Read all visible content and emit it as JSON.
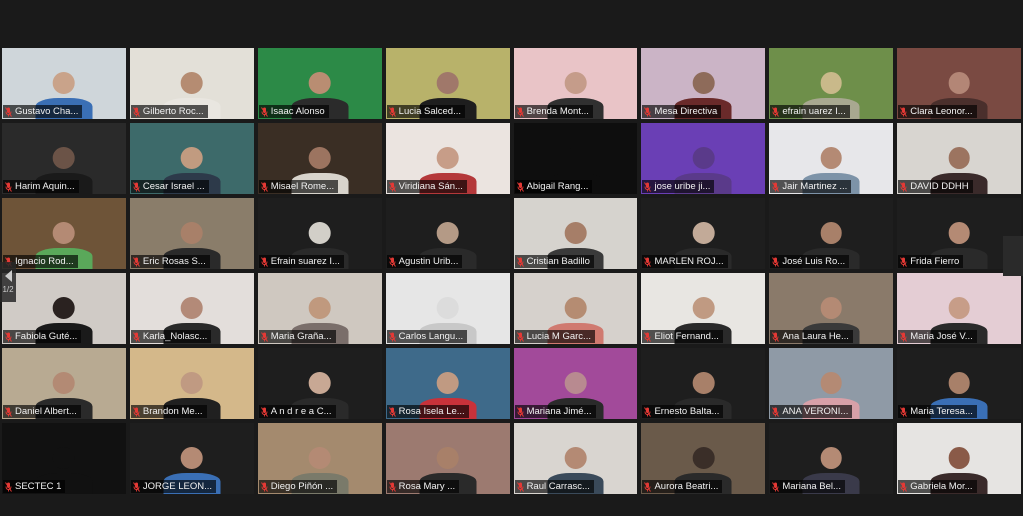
{
  "meeting": {
    "page_indicator": "1/2"
  },
  "colors": {
    "label_bg": "#000000a6",
    "muted_mic": "#e53935",
    "background": "#1a1a1a"
  },
  "participants": [
    {
      "name": "Gustavo Cha...",
      "bg": "#cfd6da",
      "skin": "#c9a38a",
      "shirt": "#3a6fb5",
      "muted": true
    },
    {
      "name": "Gilberto Roc...",
      "bg": "#e3e0d8",
      "skin": "#b58c72",
      "shirt": "#e9e6e0",
      "muted": true
    },
    {
      "name": "Isaac Alonso",
      "bg": "#2c8a47",
      "skin": "#b98d72",
      "shirt": "#2b2b2b",
      "muted": true
    },
    {
      "name": "Lucia Salced...",
      "bg": "#b8b26a",
      "skin": "#a0786a",
      "shirt": "#1e1e1e",
      "muted": true
    },
    {
      "name": "Brenda Mont...",
      "bg": "#e9c4c7",
      "skin": "#c59c8a",
      "shirt": "#303030",
      "muted": true
    },
    {
      "name": "Mesa Directiva",
      "bg": "#cbb4c6",
      "skin": "#8e6b5a",
      "shirt": "#6a2a2a",
      "muted": true
    },
    {
      "name": "efrain uarez I...",
      "bg": "#6e8f4a",
      "skin": "#c9b98a",
      "shirt": "#a8a890",
      "muted": true
    },
    {
      "name": "Clara Leonor...",
      "bg": "#7a4a42",
      "skin": "#b38676",
      "shirt": "#4a2f2c",
      "muted": true
    },
    {
      "name": "Harim Aquin...",
      "bg": "#2a2a2a",
      "skin": "#6b5347",
      "shirt": "#1a1a1a",
      "muted": true
    },
    {
      "name": "Cesar Israel ...",
      "bg": "#3d6a6a",
      "skin": "#c19b80",
      "shirt": "#2d3a4a",
      "muted": true
    },
    {
      "name": "Misael Rome...",
      "bg": "#3a2e24",
      "skin": "#9c7460",
      "shirt": "#d8d4cc",
      "muted": true
    },
    {
      "name": "Viridiana Sán...",
      "bg": "#ebe4e0",
      "skin": "#c79d88",
      "shirt": "#b4383a",
      "muted": true
    },
    {
      "name": "Abigail Rang...",
      "bg": "#0e0e0e",
      "skin": "#0e0e0e",
      "shirt": "#0e0e0e",
      "muted": true
    },
    {
      "name": "jose uribe ji...",
      "bg": "#6a3fb5",
      "skin": "#5a3a8a",
      "shirt": "#5a3a8a",
      "muted": true
    },
    {
      "name": "Jair Martinez ...",
      "bg": "#e7e7ea",
      "skin": "#b48a74",
      "shirt": "#7d93a8",
      "muted": true
    },
    {
      "name": "DAVID DDHH",
      "bg": "#d8d5d0",
      "skin": "#9c7460",
      "shirt": "#3a2a2a",
      "muted": true
    },
    {
      "name": "Ignacio Rod...",
      "bg": "#6e5438",
      "skin": "#b48a74",
      "shirt": "#5aa85a",
      "muted": true
    },
    {
      "name": "Eric Rosas S...",
      "bg": "#8a7d6a",
      "skin": "#a88069",
      "shirt": "#2a2a2a",
      "muted": true
    },
    {
      "name": "Efrain suarez I...",
      "bg": "#1e1e1e",
      "skin": "#d2cfc8",
      "shirt": "#2a2a2a",
      "muted": true
    },
    {
      "name": "Agustin Urib...",
      "bg": "#1e1e1e",
      "skin": "#b49a86",
      "shirt": "#2a2a2a",
      "muted": true
    },
    {
      "name": "Cristian Badillo",
      "bg": "#d6d3ce",
      "skin": "#a67e68",
      "shirt": "#3a3a3a",
      "muted": true
    },
    {
      "name": "MARLEN ROJ...",
      "bg": "#1e1e1e",
      "skin": "#c2aa98",
      "shirt": "#2a2a2a",
      "muted": true
    },
    {
      "name": "José Luis Ro...",
      "bg": "#1e1e1e",
      "skin": "#a88069",
      "shirt": "#2a2a2a",
      "muted": true
    },
    {
      "name": "Frida Fierro",
      "bg": "#1e1e1e",
      "skin": "#b48a74",
      "shirt": "#2a2a2a",
      "muted": true
    },
    {
      "name": "Fabiola Guté...",
      "bg": "#d0cbc6",
      "skin": "#2a2220",
      "shirt": "#1a1a1a",
      "muted": true
    },
    {
      "name": "Karla_Nolasc...",
      "bg": "#e3dedb",
      "skin": "#b38a78",
      "shirt": "#2a2a2a",
      "muted": true
    },
    {
      "name": "Maria Graña...",
      "bg": "#cfc8c0",
      "skin": "#c0997e",
      "shirt": "#7a6e6a",
      "muted": true
    },
    {
      "name": "Carlos Langu...",
      "bg": "#e6e6e6",
      "skin": "#dcdcdc",
      "shirt": "#c8c8c8",
      "muted": true
    },
    {
      "name": "Lucia M Garc...",
      "bg": "#d6d1cc",
      "skin": "#b58c72",
      "shirt": "#d07a70",
      "muted": true
    },
    {
      "name": "Eliot Fernand...",
      "bg": "#e8e6e2",
      "skin": "#c09a82",
      "shirt": "#2a2a2a",
      "muted": true
    },
    {
      "name": "Ana Laura He...",
      "bg": "#8a7a6a",
      "skin": "#b48a74",
      "shirt": "#3a3a3a",
      "muted": true
    },
    {
      "name": "Maria José V...",
      "bg": "#e4cdd4",
      "skin": "#c79d88",
      "shirt": "#2a2a2a",
      "muted": true
    },
    {
      "name": "Daniel Albert...",
      "bg": "#b8aa92",
      "skin": "#b38a74",
      "shirt": "#2a2a2a",
      "muted": true
    },
    {
      "name": "Brandon Me...",
      "bg": "#d4b88a",
      "skin": "#c09a82",
      "shirt": "#202020",
      "muted": true
    },
    {
      "name": "A n d r e a C...",
      "bg": "#1e1e1e",
      "skin": "#c8a894",
      "shirt": "#2a2a2a",
      "muted": true
    },
    {
      "name": "Rosa Isela Le...",
      "bg": "#3e6a8a",
      "skin": "#c09a82",
      "shirt": "#c8323a",
      "muted": true
    },
    {
      "name": "Mariana Jimé...",
      "bg": "#a24a9a",
      "skin": "#b88a90",
      "shirt": "#2a2a2a",
      "muted": true
    },
    {
      "name": "Ernesto Balta...",
      "bg": "#1e1e1e",
      "skin": "#a88069",
      "shirt": "#2a2a2a",
      "muted": true
    },
    {
      "name": "ANA VERONI...",
      "bg": "#8f9aa6",
      "skin": "#b48a74",
      "shirt": "#d8a0a8",
      "muted": true
    },
    {
      "name": "Maria Teresa...",
      "bg": "#1e1e1e",
      "skin": "#a88069",
      "shirt": "#3a6fb5",
      "muted": true
    },
    {
      "name": "SECTEC 1",
      "bg": "#111111",
      "skin": "#111111",
      "shirt": "#111111",
      "muted": true
    },
    {
      "name": "JORGE LEON...",
      "bg": "#1e1e1e",
      "skin": "#b48a74",
      "shirt": "#3a6fb5",
      "muted": true
    },
    {
      "name": "Diego Piñón ...",
      "bg": "#a48a6e",
      "skin": "#b48a74",
      "shirt": "#7a7a6a",
      "muted": true
    },
    {
      "name": "Rosa Mary ...",
      "bg": "#9c7a70",
      "skin": "#a88069",
      "shirt": "#2a2a2a",
      "muted": true
    },
    {
      "name": "Raul Carrasc...",
      "bg": "#d9d5d0",
      "skin": "#b48a74",
      "shirt": "#3a4a5a",
      "muted": true
    },
    {
      "name": "Aurora Beatri...",
      "bg": "#6a5a4a",
      "skin": "#3a2e28",
      "shirt": "#2a2a2a",
      "muted": true
    },
    {
      "name": "Mariana Bel...",
      "bg": "#1e1e1e",
      "skin": "#b48a74",
      "shirt": "#3a3a4a",
      "muted": true
    },
    {
      "name": "Gabriela Mor...",
      "bg": "#e6e4e2",
      "skin": "#8a5a48",
      "shirt": "#3a2a2a",
      "muted": true
    }
  ]
}
